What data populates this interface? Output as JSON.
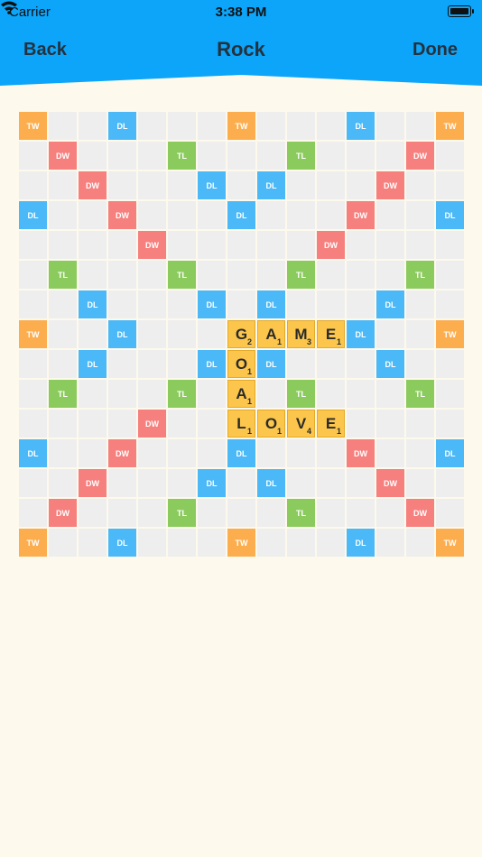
{
  "status_bar": {
    "carrier": "Carrier",
    "time": "3:38 PM"
  },
  "nav": {
    "back_label": "Back",
    "title": "Rock",
    "done_label": "Done"
  },
  "colors": {
    "header": "#0ca5f9",
    "background": "#fdf9ec",
    "tw": "#fcae4f",
    "dw": "#f6807e",
    "dl": "#4bb9f7",
    "tl": "#8bcb5e",
    "tile": "#fbc64b"
  },
  "premium_labels": {
    "tw": "TW",
    "dw": "DW",
    "dl": "DL",
    "tl": "TL"
  },
  "board": [
    [
      "tw",
      "",
      "",
      "dl",
      "",
      "",
      "",
      "tw",
      "",
      "",
      "",
      "dl",
      "",
      "",
      "tw"
    ],
    [
      "",
      "dw",
      "",
      "",
      "",
      "tl",
      "",
      "",
      "",
      "tl",
      "",
      "",
      "",
      "dw",
      ""
    ],
    [
      "",
      "",
      "dw",
      "",
      "",
      "",
      "dl",
      "",
      "dl",
      "",
      "",
      "",
      "dw",
      "",
      ""
    ],
    [
      "dl",
      "",
      "",
      "dw",
      "",
      "",
      "",
      "dl",
      "",
      "",
      "",
      "dw",
      "",
      "",
      "dl"
    ],
    [
      "",
      "",
      "",
      "",
      "dw",
      "",
      "",
      "",
      "",
      "",
      "dw",
      "",
      "",
      "",
      ""
    ],
    [
      "",
      "tl",
      "",
      "",
      "",
      "tl",
      "",
      "",
      "",
      "tl",
      "",
      "",
      "",
      "tl",
      ""
    ],
    [
      "",
      "",
      "dl",
      "",
      "",
      "",
      "dl",
      "",
      "dl",
      "",
      "",
      "",
      "dl",
      "",
      ""
    ],
    [
      "tw",
      "",
      "",
      "dl",
      "",
      "",
      "",
      "",
      "",
      "",
      "",
      "dl",
      "",
      "",
      "tw"
    ],
    [
      "",
      "",
      "dl",
      "",
      "",
      "",
      "dl",
      "",
      "dl",
      "",
      "",
      "",
      "dl",
      "",
      ""
    ],
    [
      "",
      "tl",
      "",
      "",
      "",
      "tl",
      "",
      "",
      "",
      "tl",
      "",
      "",
      "",
      "tl",
      ""
    ],
    [
      "",
      "",
      "",
      "",
      "dw",
      "",
      "",
      "",
      "",
      "",
      "",
      "",
      "",
      "",
      ""
    ],
    [
      "dl",
      "",
      "",
      "dw",
      "",
      "",
      "",
      "dl",
      "",
      "",
      "",
      "dw",
      "",
      "",
      "dl"
    ],
    [
      "",
      "",
      "dw",
      "",
      "",
      "",
      "dl",
      "",
      "dl",
      "",
      "",
      "",
      "dw",
      "",
      ""
    ],
    [
      "",
      "dw",
      "",
      "",
      "",
      "tl",
      "",
      "",
      "",
      "tl",
      "",
      "",
      "",
      "dw",
      ""
    ],
    [
      "tw",
      "",
      "",
      "dl",
      "",
      "",
      "",
      "tw",
      "",
      "",
      "",
      "dl",
      "",
      "",
      "tw"
    ]
  ],
  "tiles": [
    {
      "row": 7,
      "col": 7,
      "letter": "G",
      "score": "2"
    },
    {
      "row": 7,
      "col": 8,
      "letter": "A",
      "score": "1"
    },
    {
      "row": 7,
      "col": 9,
      "letter": "M",
      "score": "3"
    },
    {
      "row": 7,
      "col": 10,
      "letter": "E",
      "score": "1"
    },
    {
      "row": 8,
      "col": 7,
      "letter": "O",
      "score": "1"
    },
    {
      "row": 9,
      "col": 7,
      "letter": "A",
      "score": "1"
    },
    {
      "row": 10,
      "col": 7,
      "letter": "L",
      "score": "1"
    },
    {
      "row": 10,
      "col": 8,
      "letter": "O",
      "score": "1"
    },
    {
      "row": 10,
      "col": 9,
      "letter": "V",
      "score": "4"
    },
    {
      "row": 10,
      "col": 10,
      "letter": "E",
      "score": "1"
    }
  ]
}
